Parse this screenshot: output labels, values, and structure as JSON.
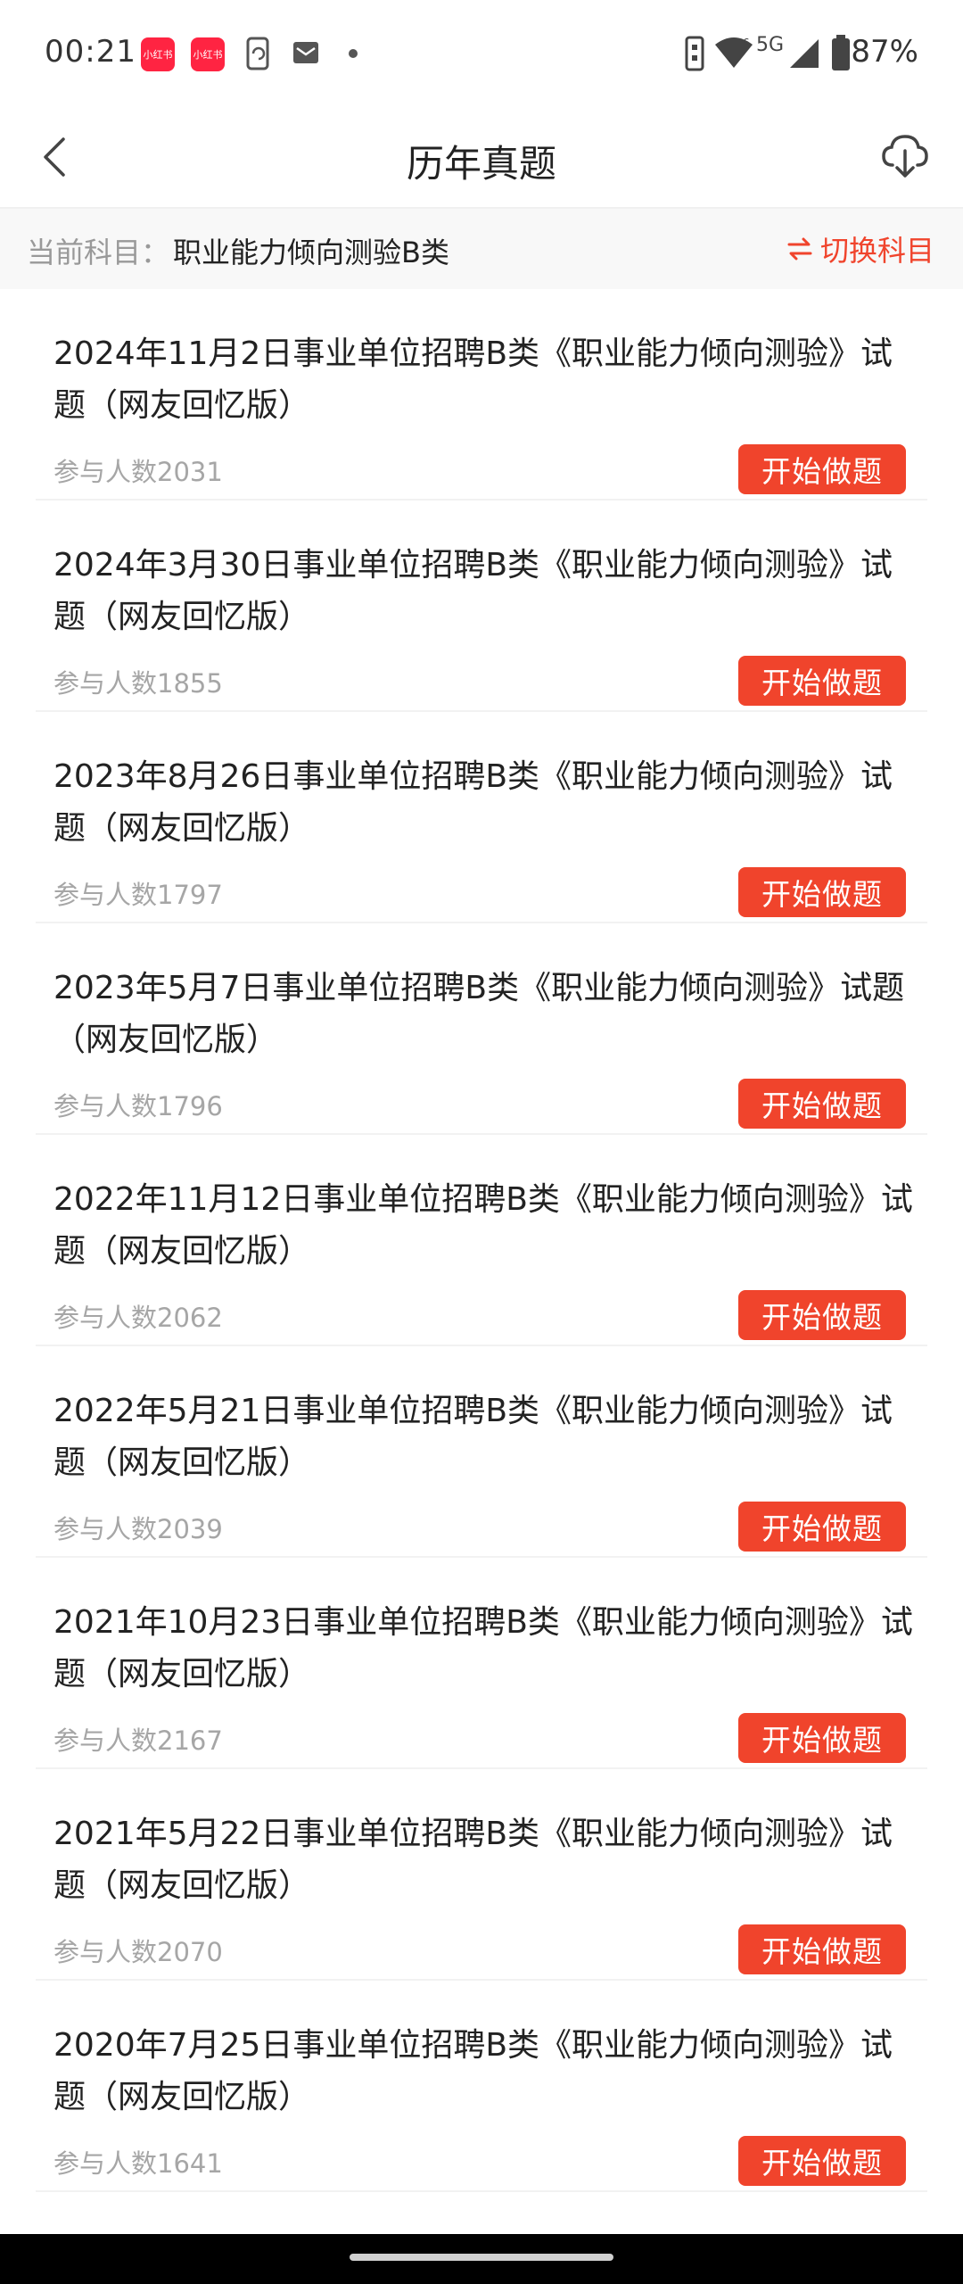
{
  "status_bar": {
    "time": "00:21",
    "app_icon_1": "小红书",
    "app_icon_2": "小红书",
    "network": "5G",
    "battery": "87%",
    "icons": [
      "xiaohongshu-icon",
      "xiaohongshu-icon",
      "phone-sync-icon",
      "mail-icon",
      "dot-icon",
      "vibrate-icon",
      "wifi-icon",
      "signal-icon",
      "battery-icon"
    ]
  },
  "header": {
    "title": "历年真题",
    "back_icon": "chevron-left-icon",
    "download_icon": "cloud-download-icon"
  },
  "subject": {
    "label": "当前科目：",
    "value": "职业能力倾向测验B类",
    "switch_label": "切换科目",
    "switch_icon": "swap-icon"
  },
  "exams": [
    {
      "title": "2024年11月2日事业单位招聘B类《职业能力倾向测验》试题（网友回忆版）",
      "count": "参与人数2031",
      "button": "开始做题"
    },
    {
      "title": "2024年3月30日事业单位招聘B类《职业能力倾向测验》试题（网友回忆版）",
      "count": "参与人数1855",
      "button": "开始做题"
    },
    {
      "title": "2023年8月26日事业单位招聘B类《职业能力倾向测验》试题（网友回忆版）",
      "count": "参与人数1797",
      "button": "开始做题"
    },
    {
      "title": "2023年5月7日事业单位招聘B类《职业能力倾向测验》试题（网友回忆版）",
      "count": "参与人数1796",
      "button": "开始做题"
    },
    {
      "title": "2022年11月12日事业单位招聘B类《职业能力倾向测验》试题（网友回忆版）",
      "count": "参与人数2062",
      "button": "开始做题"
    },
    {
      "title": "2022年5月21日事业单位招聘B类《职业能力倾向测验》试题（网友回忆版）",
      "count": "参与人数2039",
      "button": "开始做题"
    },
    {
      "title": "2021年10月23日事业单位招聘B类《职业能力倾向测验》试题（网友回忆版）",
      "count": "参与人数2167",
      "button": "开始做题"
    },
    {
      "title": "2021年5月22日事业单位招聘B类《职业能力倾向测验》试题（网友回忆版）",
      "count": "参与人数2070",
      "button": "开始做题"
    },
    {
      "title": "2020年7月25日事业单位招聘B类《职业能力倾向测验》试题（网友回忆版）",
      "count": "参与人数1641",
      "button": "开始做题"
    }
  ],
  "colors": {
    "accent": "#f0442c",
    "muted_text": "#a6a6a6",
    "primary_text": "#222222"
  }
}
